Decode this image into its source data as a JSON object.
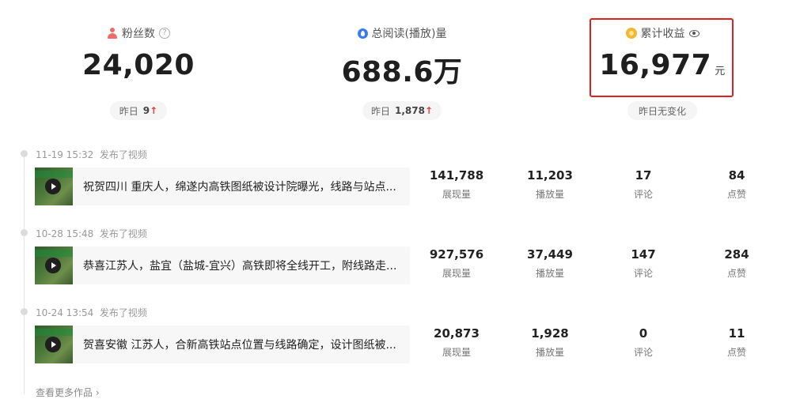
{
  "stats": {
    "fans": {
      "label": "粉丝数",
      "value": "24,020",
      "yesterday_label": "昨日",
      "yesterday_value": "9",
      "trend": "↑",
      "icon": "person-icon"
    },
    "reads": {
      "label": "总阅读(播放)量",
      "value": "688.6万",
      "yesterday_label": "昨日",
      "yesterday_value": "1,878",
      "trend": "↑",
      "icon": "drop-icon"
    },
    "income": {
      "label": "累计收益",
      "value": "16,977",
      "unit": "元",
      "yesterday_text": "昨日无变化",
      "icon": "coin-icon"
    }
  },
  "posts": [
    {
      "time": "11-19 15:32",
      "action": "发布了视频",
      "title": "祝贺四川 重庆人，绵遂内高铁图纸被设计院曝光，线路与站点...",
      "impressions": "141,788",
      "impressions_label": "展现量",
      "plays": "11,203",
      "plays_label": "播放量",
      "comments": "17",
      "comments_label": "评论",
      "likes": "84",
      "likes_label": "点赞"
    },
    {
      "time": "10-28 15:48",
      "action": "发布了视频",
      "title": "恭喜江苏人，盐宜（盐城-宜兴）高铁即将全线开工，附线路走...",
      "impressions": "927,576",
      "impressions_label": "展现量",
      "plays": "37,449",
      "plays_label": "播放量",
      "comments": "147",
      "comments_label": "评论",
      "likes": "284",
      "likes_label": "点赞"
    },
    {
      "time": "10-24 13:54",
      "action": "发布了视频",
      "title": "贺喜安徽 江苏人，合新高铁站点位置与线路确定，设计图纸被...",
      "impressions": "20,873",
      "impressions_label": "展现量",
      "plays": "1,928",
      "plays_label": "播放量",
      "comments": "0",
      "comments_label": "评论",
      "likes": "11",
      "likes_label": "点赞"
    }
  ],
  "more_link": "查看更多作品",
  "colors": {
    "accent_red": "#e02020",
    "trend_red": "#e5413b",
    "coin": "#f5b731",
    "drop": "#3a7bf0",
    "person": "#f06a6a"
  }
}
